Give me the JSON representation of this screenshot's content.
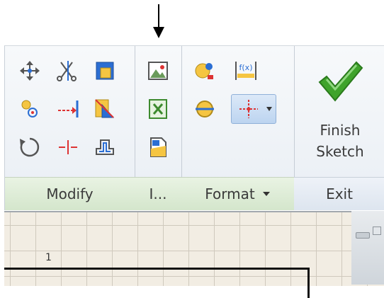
{
  "ribbon": {
    "panels": {
      "modify": {
        "label": "Modify"
      },
      "insert": {
        "label": "I..."
      },
      "format": {
        "label": "Format"
      },
      "exit": {
        "label": "Exit",
        "finish_line1": "Finish",
        "finish_line2": "Sketch"
      }
    }
  },
  "canvas": {
    "row_label": "1"
  },
  "icons": {
    "move": "move-icon",
    "trim": "scissors-icon",
    "extend": "extend-icon",
    "copy": "copy-icon",
    "split": "split-icon",
    "scale": "scale-icon",
    "rotate": "rotate-icon",
    "stretch": "stretch-icon",
    "offset": "offset-icon",
    "image": "image-icon",
    "points": "excel-points-icon",
    "acad": "acad-file-icon",
    "show_format": "show-format-icon",
    "param": "fx-param-icon",
    "construction": "construction-icon",
    "center_point": "center-point-icon",
    "finish": "checkmark-icon"
  },
  "colors": {
    "panel_label_green": "#d4e6cc",
    "checkmark_green": "#3fa32b",
    "canvas_bg": "#f2ede3"
  }
}
